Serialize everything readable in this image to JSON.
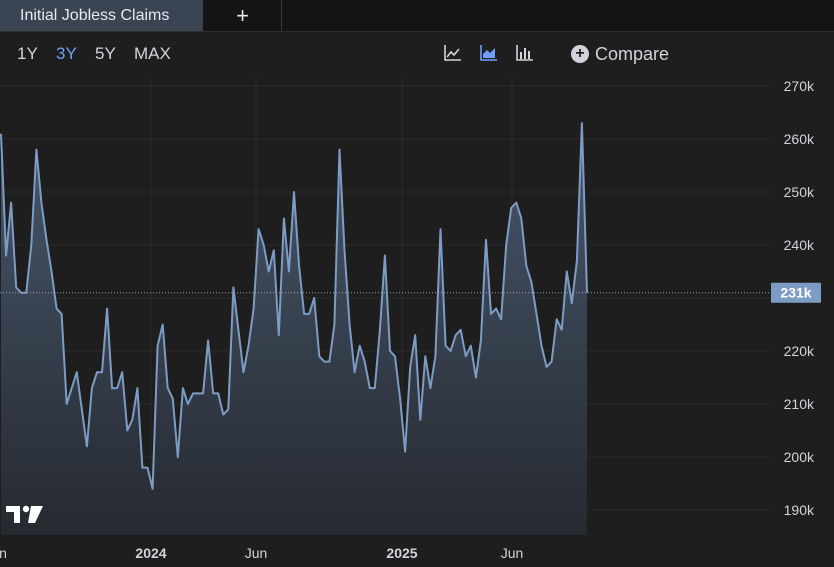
{
  "tabs": {
    "active_label": "Initial Jobless Claims",
    "add_label": "+"
  },
  "toolbar": {
    "ranges": [
      "1Y",
      "3Y",
      "5Y",
      "MAX"
    ],
    "active_range": "3Y",
    "chart_type_icons": [
      "line-chart-icon",
      "area-chart-icon",
      "bar-chart-icon"
    ],
    "active_chart_type": "area-chart-icon",
    "compare_label": "Compare"
  },
  "colors": {
    "line": "#7d9cc4",
    "area_top": "#4a5a70",
    "area_bottom": "#262a31",
    "active_accent": "#6f9ff5",
    "background": "#1e1e1e",
    "last_value_badge": "#7d9cc4"
  },
  "chart_data": {
    "type": "area",
    "title": "Initial Jobless Claims",
    "x_tick_labels": [
      "n",
      "2024",
      "Jun",
      "2025",
      "Jun"
    ],
    "y_tick_labels": [
      "270k",
      "260k",
      "250k",
      "240k",
      "230k",
      "220k",
      "210k",
      "200k",
      "190k"
    ],
    "ylim": [
      185000,
      272000
    ],
    "grid": true,
    "last_value_label": "231k",
    "last_value": 231000,
    "series": [
      {
        "values": [
          261000,
          238000,
          248000,
          232000,
          231000,
          231000,
          240000,
          258000,
          248000,
          241000,
          235000,
          228000,
          227000,
          210000,
          213000,
          216000,
          209000,
          202000,
          213000,
          216000,
          216000,
          228000,
          213000,
          213000,
          216000,
          205000,
          207000,
          213000,
          198000,
          198000,
          194000,
          221000,
          225000,
          213000,
          211000,
          200000,
          213000,
          210000,
          212000,
          212000,
          212000,
          222000,
          212000,
          212000,
          208000,
          209000,
          232000,
          224000,
          216000,
          221000,
          228000,
          243000,
          240000,
          235000,
          239000,
          223000,
          245000,
          235000,
          250000,
          236000,
          227000,
          227000,
          230000,
          219000,
          218000,
          218000,
          225000,
          258000,
          239000,
          225000,
          216000,
          221000,
          218000,
          213000,
          213000,
          224000,
          238000,
          220000,
          219000,
          211000,
          201000,
          217000,
          223000,
          207000,
          219000,
          213000,
          219000,
          243000,
          221000,
          220000,
          223000,
          224000,
          219000,
          221000,
          215000,
          222000,
          241000,
          227000,
          228000,
          226000,
          240000,
          247000,
          248000,
          245000,
          236000,
          233000,
          227000,
          221000,
          217000,
          218000,
          226000,
          224000,
          235000,
          229000,
          237000,
          263000,
          231000
        ]
      }
    ]
  }
}
